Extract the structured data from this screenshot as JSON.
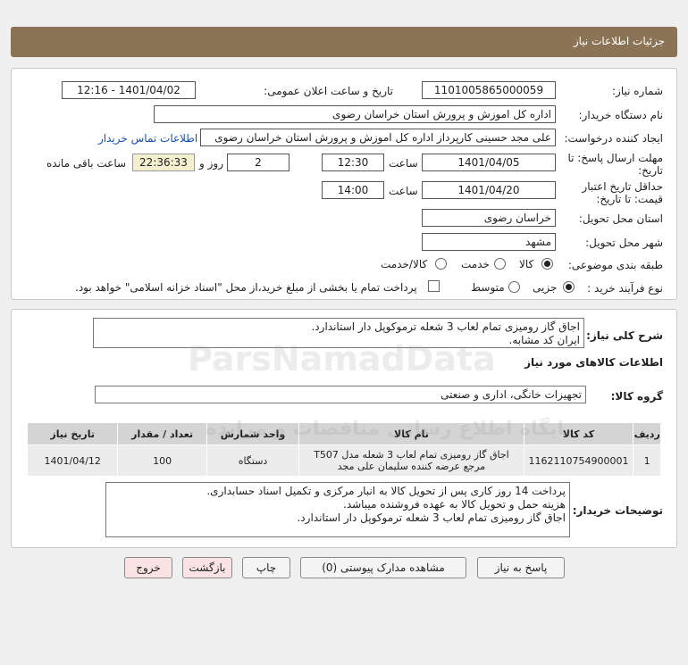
{
  "header": {
    "title": "جزئیات اطلاعات نیاز"
  },
  "form": {
    "need_number_label": "شماره نیاز:",
    "need_number": "1101005865000059",
    "announce_label": "تاریخ و ساعت اعلان عمومی:",
    "announce_value": "1401/04/02 - 12:16",
    "buyer_org_label": "نام دستگاه خریدار:",
    "buyer_org": "اداره کل اموزش و پرورش استان خراسان رضوی",
    "creator_label": "ایجاد کننده درخواست:",
    "creator": "علی مجد حسینی کارپرداز اداره کل اموزش و پرورش استان خراسان رضوی",
    "contact_link": "اطلاعات تماس خریدار",
    "deadline_label_1": "مهلت ارسال پاسخ: تا",
    "deadline_label_2": "تاریخ:",
    "deadline_date": "1401/04/05",
    "time_label": "ساعت",
    "deadline_time": "12:30",
    "days_value": "2",
    "days_label": "روز و",
    "remaining_time": "22:36:33",
    "remaining_label": "ساعت باقی مانده",
    "validity_label_1": "حداقل تاریخ اعتبار",
    "validity_label_2": "قیمت: تا تاریخ:",
    "validity_date": "1401/04/20",
    "validity_time_label": "ساعت",
    "validity_time": "14:00",
    "province_label": "استان محل تحویل:",
    "province": "خراسان رضوی",
    "city_label": "شهر محل تحویل:",
    "city": "مشهد",
    "category_label": "طبقه بندی موضوعی:",
    "category_options": [
      "کالا",
      "خدمت",
      "کالا/خدمت"
    ],
    "process_label": "نوع فرآیند خرید :",
    "process_options": [
      "جزیی",
      "متوسط"
    ],
    "payment_note": "پرداخت تمام یا بخشی از مبلغ خرید،از محل \"اسناد خزانه اسلامی\" خواهد بود."
  },
  "summary": {
    "label": "شرح کلی نیاز:",
    "text": "اجاق گاز رومیزی تمام لعاب 3 شعله ترموکوپل دار استاندارد.\nایران کد مشابه."
  },
  "goods": {
    "section_title": "اطلاعات کالاهای مورد نیاز",
    "group_label": "گروه کالا:",
    "group_value": "تجهیزات خانگی، اداری و صنعتی",
    "columns": [
      "ردیف",
      "کد کالا",
      "نام کالا",
      "واحد شمارش",
      "تعداد / مقدار",
      "تاریخ نیاز"
    ],
    "rows": [
      {
        "index": "1",
        "code": "1162110754900001",
        "name": "اجاق گاز رومیزی تمام لعاب 3 شعله مدل T507 مرجع عرضه کننده سلیمان علی مجد",
        "unit": "دستگاه",
        "qty": "100",
        "date": "1401/04/12"
      }
    ]
  },
  "buyer_notes": {
    "label": "توضیحات خریدار:",
    "text": "پرداخت 14 روز کاری پس از تحویل کالا به انبار مرکزی و تکمیل اسناد حسابداری.\nهزینه حمل و تحویل کالا به عهده فروشنده میباشد.\nاجاق گاز رومیزی تمام لعاب 3 شعله ترموکوپل دار استاندارد."
  },
  "buttons": {
    "reply": "پاسخ به نیاز",
    "docs": "مشاهده مدارک پیوستی (0)",
    "print": "چاپ",
    "back": "بازگشت",
    "exit": "خروج"
  },
  "watermark": {
    "brand": "ParsNamadData",
    "tagline": "پایگاه اطلاع رسانی مناقصات و مزایده"
  },
  "colors": {
    "header": "#8b7355",
    "link": "#1a4fb3",
    "remaining_bg": "#f3efcf"
  }
}
